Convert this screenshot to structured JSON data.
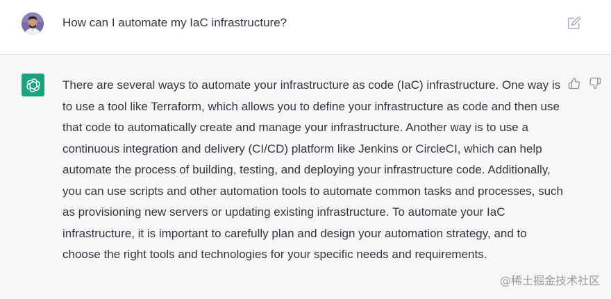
{
  "user_message": {
    "text": "How can I automate my IaC infrastructure?",
    "avatar_icon": "user-avatar",
    "edit_icon": "edit-icon"
  },
  "assistant_message": {
    "avatar_icon": "openai-logo-icon",
    "avatar_color": "#19a37f",
    "text": "There are several ways to automate your infrastructure as code (IaC) infrastructure. One way is to use a tool like Terraform, which allows you to define your infrastructure as code and then use that code to automatically create and manage your infrastructure. Another way is to use a continuous integration and delivery (CI/CD) platform like Jenkins or CircleCI, which can help automate the process of building, testing, and deploying your infrastructure code. Additionally, you can use scripts and other automation tools to automate common tasks and processes, such as provisioning new servers or updating existing infrastructure. To automate your IaC infrastructure, it is important to carefully plan and design your automation strategy, and to choose the right tools and technologies for your specific needs and requirements.",
    "feedback_icons": [
      "thumbs-up-icon",
      "thumbs-down-icon"
    ]
  },
  "watermark": "@稀土掘金技术社区",
  "colors": {
    "text": "#343541",
    "assistant_background": "#f7f7f8",
    "user_background": "#ffffff"
  }
}
